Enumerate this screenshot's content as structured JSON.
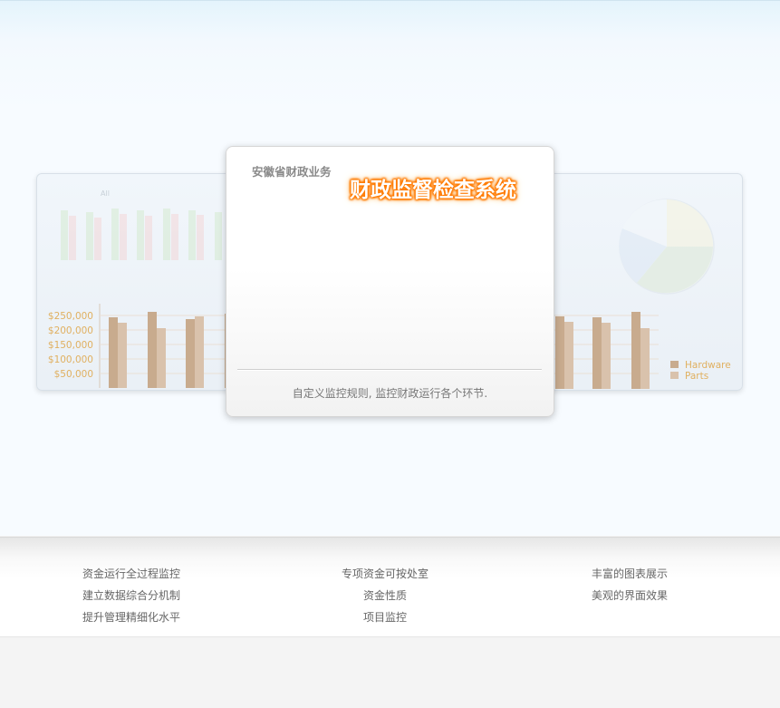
{
  "main_card": {
    "subtitle": "安徽省财政业务",
    "title": "财政监督检查系统",
    "description": "自定义监控规则, 监控财政运行各个环节."
  },
  "left_preview": {
    "chart_title": "All",
    "y_ticks": [
      "$250,000",
      "$200,000",
      "$150,000",
      "$100,000",
      "$50,000"
    ]
  },
  "right_preview": {
    "legend": [
      "Hardware",
      "Parts"
    ]
  },
  "features": {
    "col1": [
      "资金运行全过程监控",
      "建立数据综合分机制",
      "提升管理精细化水平"
    ],
    "col2": [
      "专项资金可按处室",
      "资金性质",
      "项目监控"
    ],
    "col3": [
      "丰富的图表展示",
      "美观的界面效果"
    ]
  },
  "colors": {
    "title_glow": "#ff7a00",
    "bar_a": "#c8ab8e",
    "bar_b": "#d9c2ac",
    "tick_text": "#e0b060"
  }
}
